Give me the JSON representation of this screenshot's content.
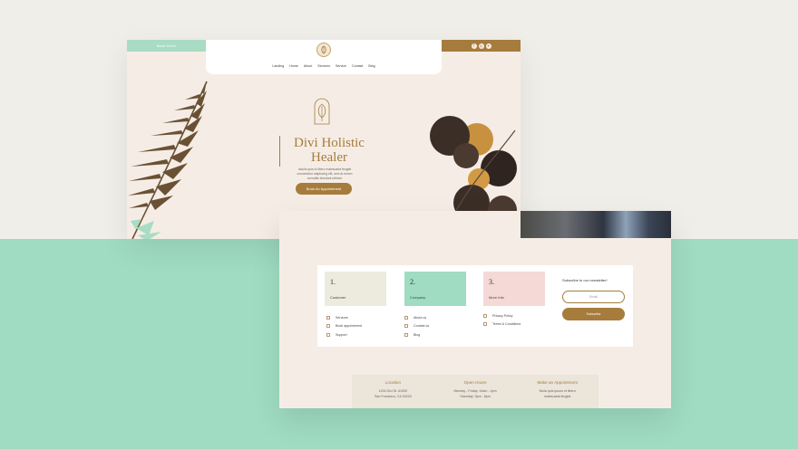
{
  "hero_page": {
    "topbar": {
      "book_link": "Book here!",
      "social_icons": [
        "facebook-icon",
        "instagram-icon",
        "twitter-icon"
      ]
    },
    "nav": [
      "Landing",
      "Home",
      "About",
      "Services",
      "Service",
      "Contact",
      "Blog"
    ],
    "hero": {
      "title_line1": "Divi Holistic",
      "title_line2": "Healer",
      "text_line1": "Iaculis quis ut libero malesuada feugiat",
      "text_line2": "consectetur adipiscing elit, sed do eiusm",
      "text_line3": "convallis tincidunt ultrices",
      "button": "Book An Appointment"
    }
  },
  "footer_page": {
    "columns": [
      {
        "num": "1.",
        "label": "Customer",
        "color": "#ecebdd",
        "links": [
          "Services",
          "Book appointment",
          "Support"
        ]
      },
      {
        "num": "2.",
        "label": "Company",
        "color": "#9fdcc2",
        "links": [
          "About us",
          "Contact us",
          "Blog"
        ]
      },
      {
        "num": "3.",
        "label": "More Info",
        "color": "#f5d9d6",
        "links": [
          "Privacy Policy",
          "Terms & Conditions"
        ]
      }
    ],
    "newsletter": {
      "title": "Subscribe to our newsletter!",
      "email_placeholder": "Email",
      "button": "Subscribe"
    },
    "info": [
      {
        "heading": "Location",
        "line1": "1234 Divi St. #1000",
        "line2": "San Francisco, CA 94220"
      },
      {
        "heading": "Open Hours",
        "line1": "Monday - Friday: 10am - 4pm",
        "line2": "Saturday: 9pm - 8pm"
      },
      {
        "heading": "Make an Appointment",
        "line1": "Nulla quis ipsum et libero",
        "line2": "malesuada feugiat"
      }
    ]
  },
  "colors": {
    "brown": "#a67c3c",
    "mint": "#9fdcc2",
    "cream": "#f5ede5",
    "background": "#f0eee9"
  }
}
